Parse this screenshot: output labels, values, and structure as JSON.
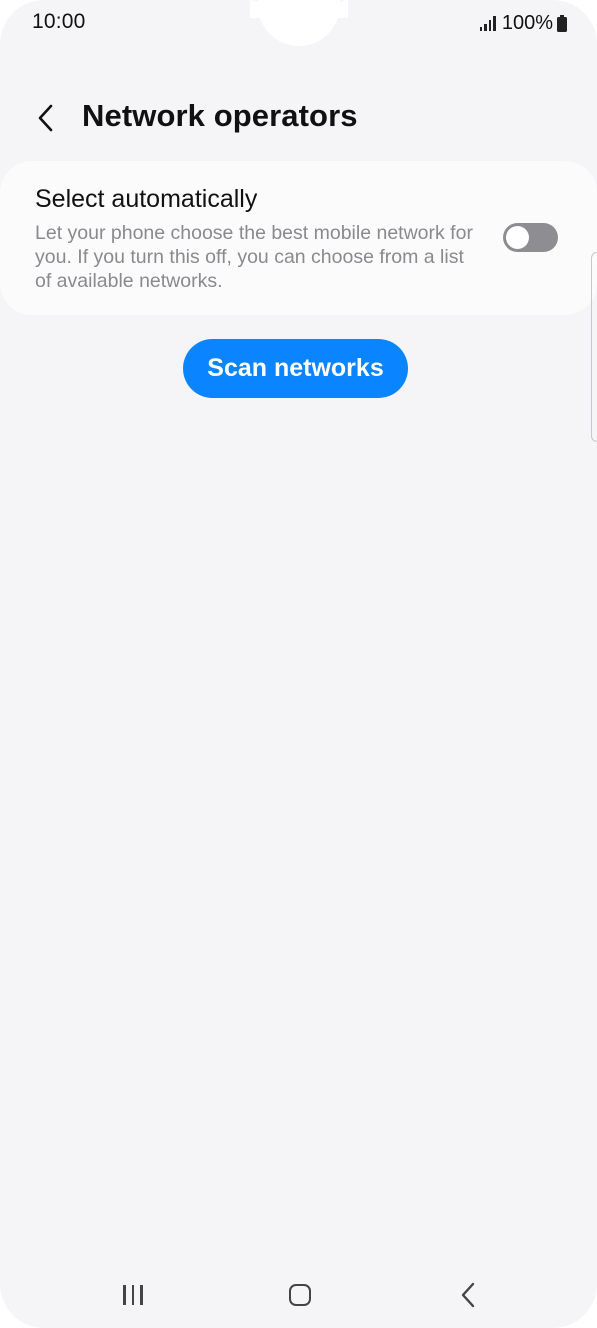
{
  "status_bar": {
    "time": "10:00",
    "battery_percent": "100%",
    "signal_icon": "signal-bars-icon",
    "battery_icon": "battery-full-icon"
  },
  "header": {
    "back_icon": "chevron-left-icon",
    "title": "Network operators"
  },
  "select_automatically": {
    "title": "Select automatically",
    "description": "Let your phone choose the best mobile network for you. If you turn this off, you can choose from a list of available networks.",
    "enabled": false
  },
  "scan_button": {
    "label": "Scan networks"
  },
  "navigation_bar": {
    "recents_icon": "recents-icon",
    "home_icon": "home-icon",
    "back_icon": "back-icon"
  },
  "colors": {
    "background": "#f5f5f7",
    "card": "#fbfbfc",
    "accent": "#0a84ff",
    "toggle_off": "#8d8d92",
    "secondary_text": "#8a8a8e"
  }
}
